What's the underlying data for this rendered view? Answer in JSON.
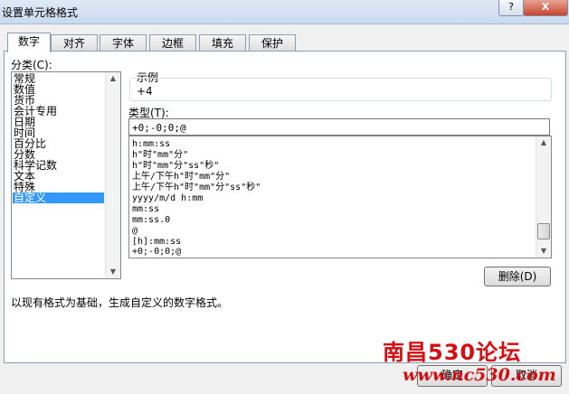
{
  "window": {
    "title": "设置单元格格式",
    "help": "?",
    "close": "X"
  },
  "tabs": [
    "数字",
    "对齐",
    "字体",
    "边框",
    "填充",
    "保护"
  ],
  "category": {
    "label": "分类(C):",
    "items": [
      "常规",
      "数值",
      "货币",
      "会计专用",
      "日期",
      "时间",
      "百分比",
      "分数",
      "科学记数",
      "文本",
      "特殊",
      "自定义"
    ],
    "selected": "自定义"
  },
  "sample": {
    "label": "示例",
    "value": "+4"
  },
  "type": {
    "label": "类型(T):",
    "value": "+0;-0;0;@",
    "formats": [
      "h:mm:ss",
      "h\"时\"mm\"分\"",
      "h\"时\"mm\"分\"ss\"秒\"",
      "上午/下午h\"时\"mm\"分\"",
      "上午/下午h\"时\"mm\"分\"ss\"秒\"",
      "yyyy/m/d h:mm",
      "mm:ss",
      "mm:ss.0",
      "@",
      "[h]:mm:ss",
      "+0;-0;0;@"
    ]
  },
  "buttons": {
    "delete": "删除(D)",
    "ok": "确定",
    "cancel": "取消"
  },
  "description": "以现有格式为基础，生成自定义的数字格式。",
  "watermark": {
    "line1": "南昌530论坛",
    "line2": "www.nc530.com"
  }
}
